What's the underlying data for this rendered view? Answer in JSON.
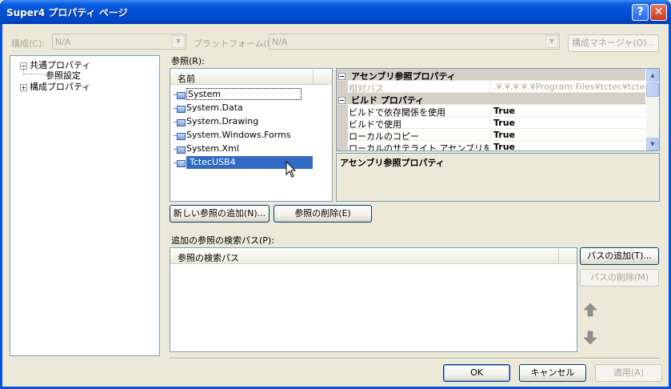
{
  "window": {
    "title": "Super4 プロパティ ページ"
  },
  "config": {
    "label": "構成(C):",
    "value": "N/A",
    "platform_label": "プラットフォーム(P):",
    "platform_value": "N/A",
    "manager_button": "構成マネージャ(O)..."
  },
  "tree": {
    "common": "共通プロパティ",
    "ref_settings": "参照設定",
    "config_props": "構成プロパティ"
  },
  "references": {
    "label": "参照(R):",
    "column": "名前",
    "items": [
      "System",
      "System.Data",
      "System.Drawing",
      "System.Windows.Forms",
      "System.Xml",
      "TctecUSB4"
    ]
  },
  "propgrid": {
    "cat1": "アセンブリ参照プロパティ",
    "relpath_name": "相対パス",
    "relpath_value": ".¥.¥.¥.¥.¥Program Files¥tctec¥tctec",
    "cat2": "ビルド プロパティ",
    "rows": [
      {
        "name": "ビルドで依存関係を使用",
        "value": "True"
      },
      {
        "name": "ビルドで使用",
        "value": "True"
      },
      {
        "name": "ローカルのコピー",
        "value": "True"
      },
      {
        "name": "ローカルのサテライト アセンブリをコピー",
        "value": "True"
      }
    ],
    "description": "アセンブリ参照プロパティ"
  },
  "buttons": {
    "add_ref": "新しい参照の追加(N)...",
    "remove_ref": "参照の削除(E)",
    "add_path": "パスの追加(T)...",
    "remove_path": "パスの削除(M)",
    "ok": "OK",
    "cancel": "キャンセル",
    "apply": "適用(A)"
  },
  "search": {
    "label": "追加の参照の検索パス(P):",
    "column": "参照の検索パス"
  },
  "icons": {
    "up": "arrow-up-icon",
    "down": "arrow-down-icon"
  }
}
